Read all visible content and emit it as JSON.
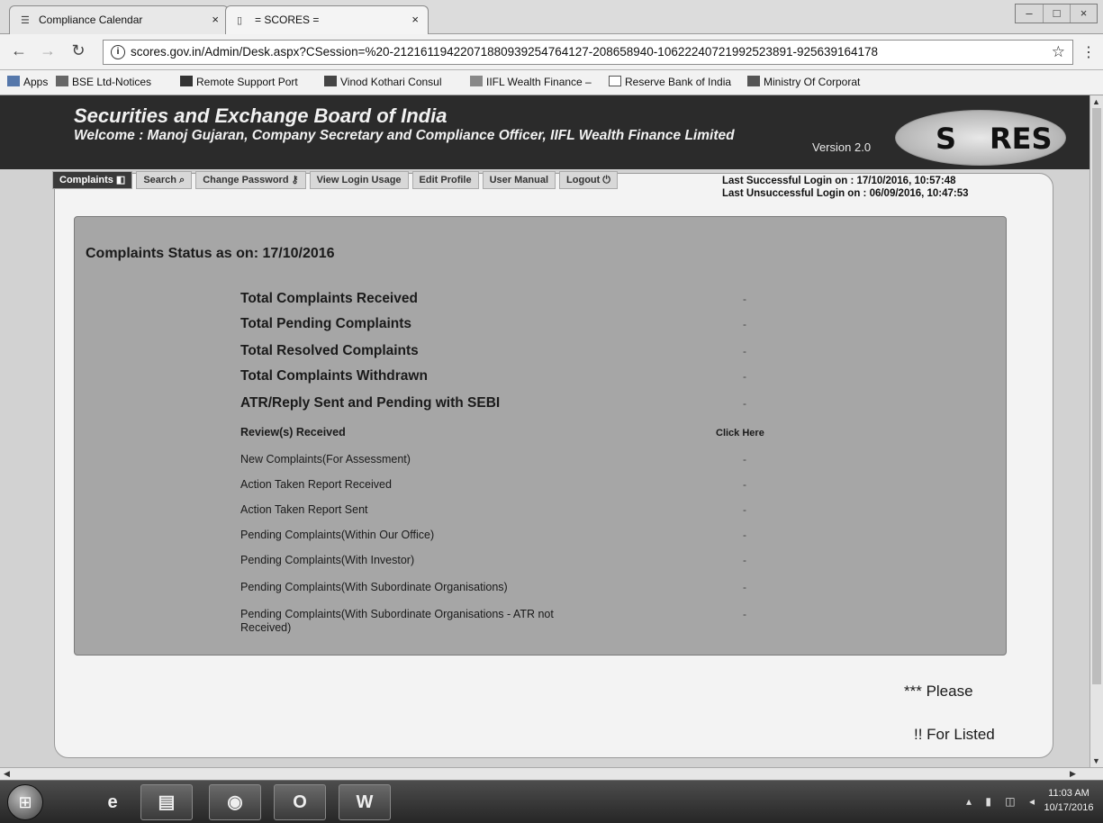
{
  "browser": {
    "tabs": [
      {
        "label": "Compliance Calendar",
        "icon": "bse-logo-icon",
        "close": "×"
      },
      {
        "label": "= SCORES =",
        "icon": "page-icon",
        "close": "×"
      }
    ],
    "window_controls": [
      "–",
      "□",
      "×"
    ],
    "url": "scores.gov.in/Admin/Desk.aspx?CSession=%20-2121611942207188093925476​4127-208658940-106222407219925​23891-925639164178",
    "bookmarks": [
      {
        "label": "Apps",
        "icon": "apps-icon"
      },
      {
        "label": "BSE Ltd-Notices",
        "icon": "bse-logo-icon"
      },
      {
        "label": "Remote Support Port",
        "icon": "remote-support-icon"
      },
      {
        "label": "Vinod Kothari Consul",
        "icon": "vinod-kothari-icon"
      },
      {
        "label": "IIFL Wealth Finance –",
        "icon": "iifl-icon"
      },
      {
        "label": "Reserve Bank of India",
        "icon": "page-icon"
      },
      {
        "label": "Ministry Of Corporat",
        "icon": "emblem-icon"
      }
    ]
  },
  "header": {
    "title": "Securities and Exchange Board of India",
    "welcome": "Welcome : Manoj Gujaran, Company Secretary and Compliance Officer, IIFL Wealth Finance Limited",
    "version": "Version 2.0",
    "logo_text_left": "S",
    "logo_text_right": "RES"
  },
  "menu": {
    "items": [
      {
        "label": "Complaints",
        "icon": "complaints-icon"
      },
      {
        "label": "Search",
        "icon": "search-icon"
      },
      {
        "label": "Change Password",
        "icon": "key-icon"
      },
      {
        "label": "View Login Usage",
        "icon": ""
      },
      {
        "label": "Edit Profile",
        "icon": ""
      },
      {
        "label": "User Manual",
        "icon": ""
      },
      {
        "label": "Logout",
        "icon": "logout-icon"
      }
    ]
  },
  "login": {
    "last_success": "Last Successful Login on : 17/10/2016, 10:57:48",
    "last_unsuccess": "Last Unsuccessful Login on : 06/09/2016, 10:47:53"
  },
  "status": {
    "title": "Complaints Status as on: 17/10/2016",
    "totals": [
      {
        "label": "Total Complaints Received",
        "value": "-"
      },
      {
        "label": "Total Pending Complaints",
        "value": "-"
      },
      {
        "label": "Total Resolved Complaints",
        "value": "-"
      },
      {
        "label": "Total Complaints Withdrawn",
        "value": "-"
      },
      {
        "label": "ATR/Reply Sent and Pending with SEBI",
        "value": "-"
      }
    ],
    "reviews_label": "Review(s) Received",
    "click_here": "Click Here",
    "details": [
      {
        "label": "New Complaints(For Assessment)",
        "value": "-"
      },
      {
        "label": "Action Taken Report Received",
        "value": "-"
      },
      {
        "label": "Action Taken Report Sent",
        "value": "-"
      },
      {
        "label": "Pending Complaints(Within Our Office)",
        "value": "-"
      },
      {
        "label": "Pending Complaints(With Investor)",
        "value": "-"
      },
      {
        "label": "Pending Complaints(With Subordinate Organisations)",
        "value": "-"
      },
      {
        "label": "Pending Complaints(With Subordinate Organisations - ATR not",
        "value": "-"
      }
    ],
    "details_last_line2": "Received)"
  },
  "notes": {
    "note1": "*** Please",
    "note2": "!! For Listed"
  },
  "taskbar": {
    "start": "⊞",
    "buttons": [
      {
        "name": "ie-taskbar-button",
        "glyph": "e"
      },
      {
        "name": "explorer-taskbar-button",
        "glyph": "▤"
      },
      {
        "name": "chrome-taskbar-button",
        "glyph": "◉"
      },
      {
        "name": "outlook-taskbar-button",
        "glyph": "O"
      },
      {
        "name": "word-taskbar-button",
        "glyph": "W"
      }
    ],
    "tray": "▴ ▮ ◫ ◂",
    "time": "11:03 AM",
    "date": "10/17/2016"
  }
}
